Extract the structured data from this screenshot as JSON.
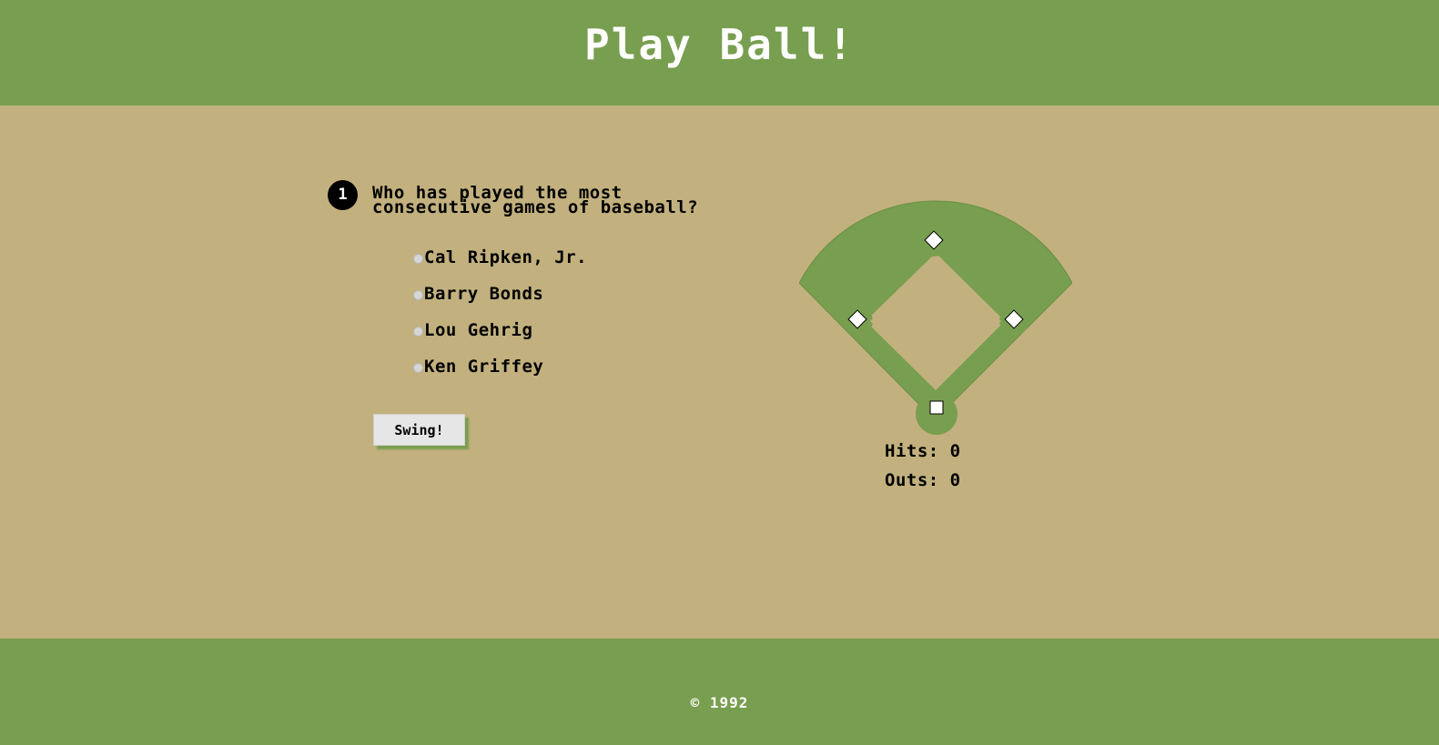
{
  "header": {
    "title": "Play Ball!"
  },
  "question": {
    "number": "1",
    "text": "Who has played the most consecutive games of baseball?",
    "choices": [
      {
        "label": "Cal Ripken, Jr."
      },
      {
        "label": "Barry Bonds"
      },
      {
        "label": "Lou Gehrig"
      },
      {
        "label": "Ken Griffey"
      }
    ],
    "submit_label": "Swing!"
  },
  "scoreboard": {
    "hits_label": "Hits:",
    "hits": "0",
    "outs_label": "Outs:",
    "outs": "0"
  },
  "footer": {
    "copyright": "© 1992"
  },
  "colors": {
    "grass": "#789e4f",
    "dirt": "#c2b17e",
    "base": "#ffffff",
    "text": "#000000"
  }
}
